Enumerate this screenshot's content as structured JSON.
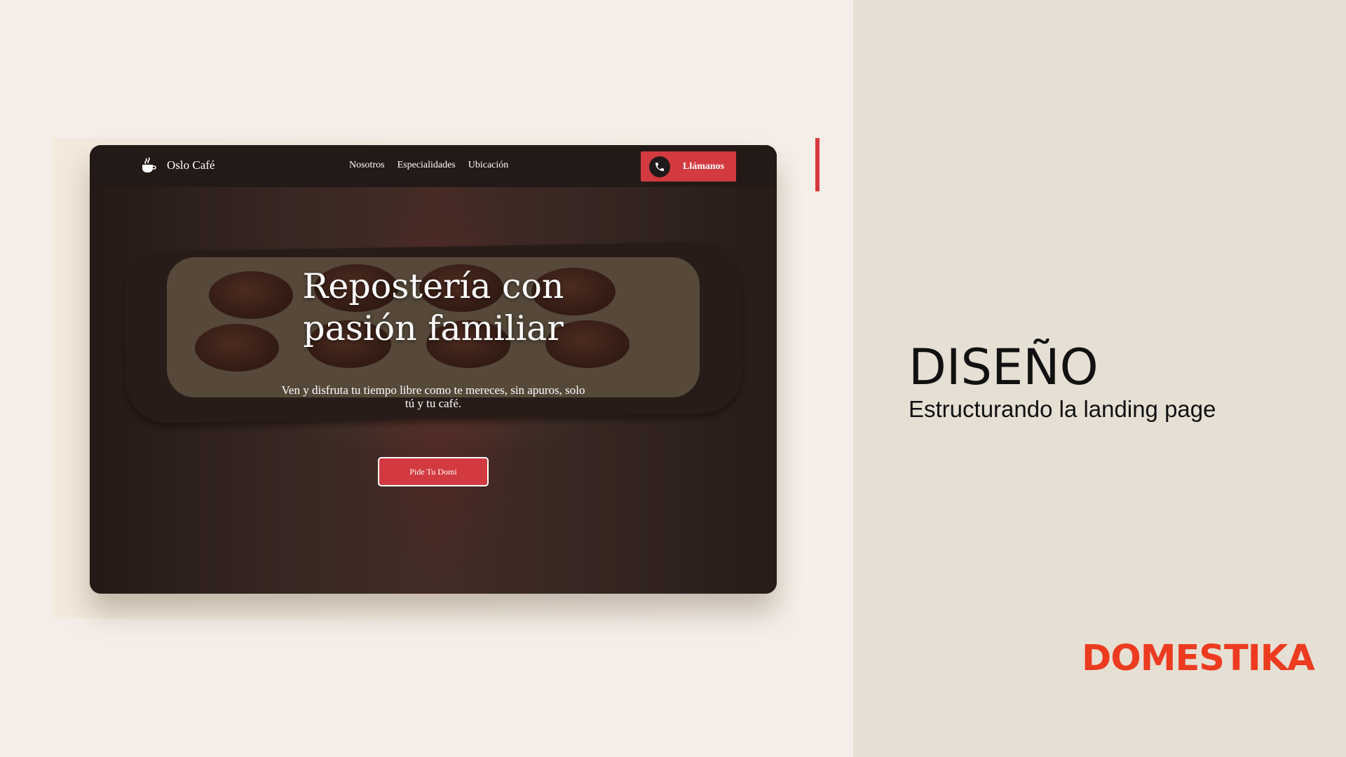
{
  "colors": {
    "accent_red": "#d23a40",
    "nav_dark": "#231916",
    "left_background": "#f5eee8",
    "right_background": "#e6dfd3",
    "logo_red": "#ec3b1f"
  },
  "site": {
    "brand": {
      "icon": "coffee-cup-icon",
      "name": "Oslo Café"
    },
    "nav": [
      {
        "label": "Nosotros"
      },
      {
        "label": "Especialidades"
      },
      {
        "label": "Ubicación"
      }
    ],
    "call_button": {
      "icon": "phone-icon",
      "label": "Llámanos"
    },
    "hero": {
      "title_line1": "Repostería con",
      "title_line2": "pasión familiar",
      "subtitle": "Ven y disfruta tu tiempo libre como te mereces, sin apuros, solo tú y tu café.",
      "button_label": "Pide Tu Domi"
    }
  },
  "slide": {
    "title": "DISEÑO",
    "subtitle": "Estructurando la landing page",
    "logo": "DOMESTIKA"
  }
}
